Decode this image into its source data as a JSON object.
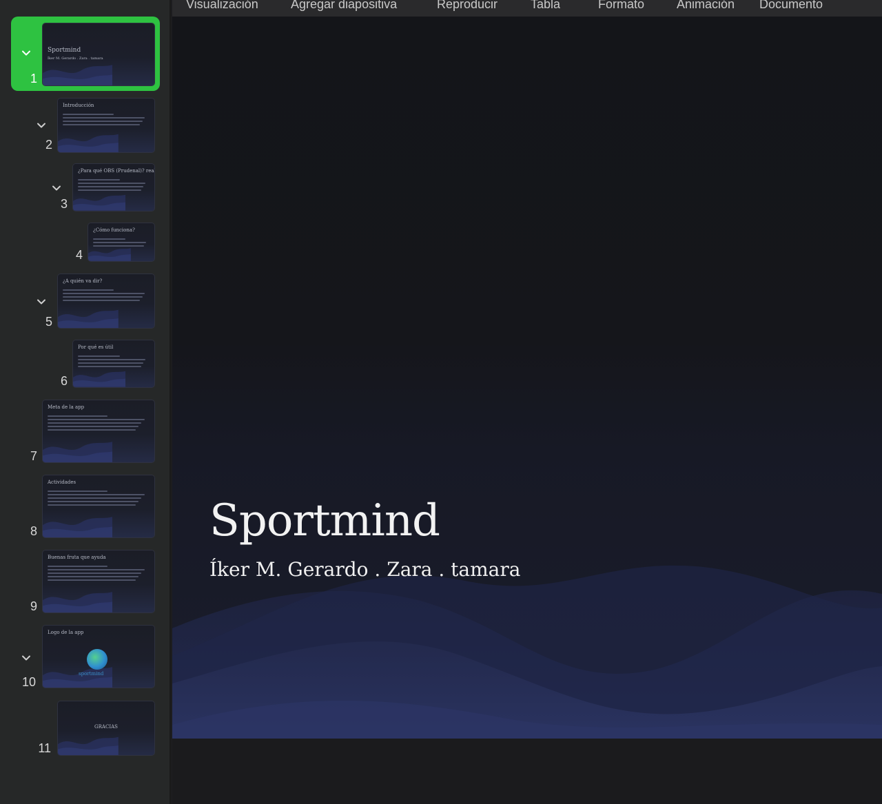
{
  "menubar": {
    "items": [
      "Visualización",
      "Agregar diapositiva",
      "Reproducir",
      "Tabla",
      "Formato",
      "Animación",
      "Documento"
    ]
  },
  "navigator": {
    "slides": [
      {
        "number": "1",
        "title": "Sportmind",
        "subtitle": "Íker M. Gerardo . Zara . tamara",
        "selected": true,
        "collapsible": true
      },
      {
        "number": "2",
        "title": "Introducción",
        "collapsible": true
      },
      {
        "number": "3",
        "title": "¿Para qué OBS (Prudenal)? reales",
        "collapsible": true
      },
      {
        "number": "4",
        "title": "¿Cómo funciona?",
        "collapsible": false
      },
      {
        "number": "5",
        "title": "¿A quién va dir?",
        "collapsible": true
      },
      {
        "number": "6",
        "title": "Por qué es útil",
        "collapsible": false
      },
      {
        "number": "7",
        "title": "Meta de la app",
        "collapsible": false
      },
      {
        "number": "8",
        "title": "Actividades",
        "collapsible": false
      },
      {
        "number": "9",
        "title": "Buenas fruta que ayuda",
        "collapsible": false
      },
      {
        "number": "10",
        "title": "Logo de la app",
        "logo_text": "sportmind",
        "collapsible": true
      },
      {
        "number": "11",
        "title": "GRACIAS",
        "collapsible": false
      }
    ]
  },
  "current_slide": {
    "title": "Sportmind",
    "subtitle": "Íker M. Gerardo . Zara . tamara"
  },
  "colors": {
    "selection": "#2ec241",
    "slide_background": "#15161b",
    "wave": "#2a3360"
  }
}
